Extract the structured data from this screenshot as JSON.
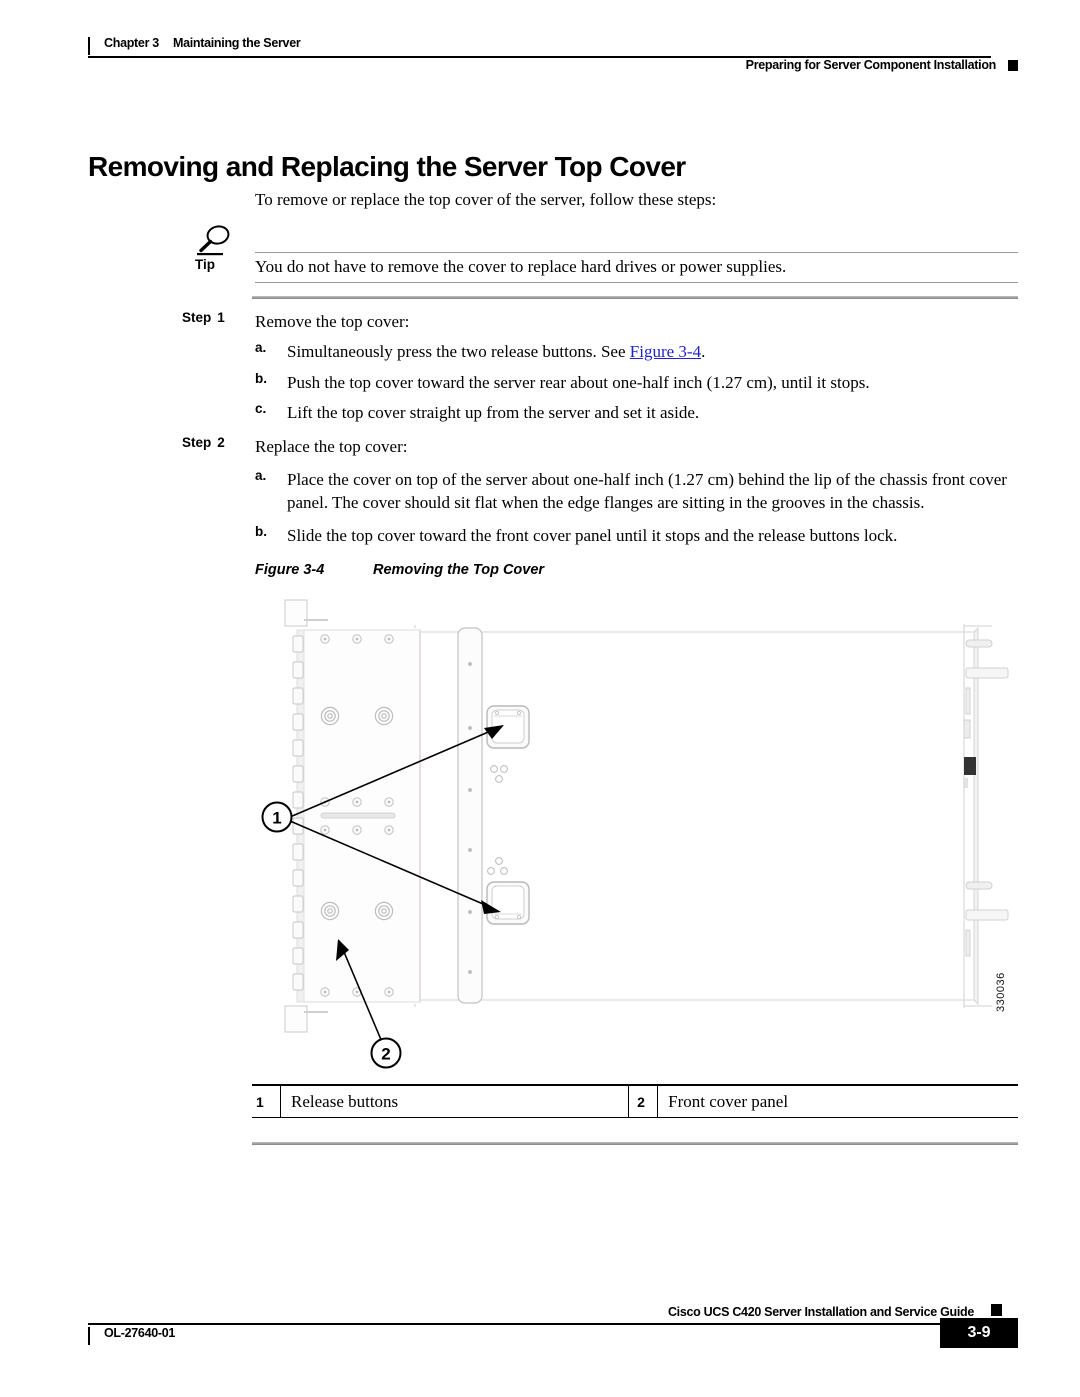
{
  "header": {
    "chapter_number": "Chapter 3",
    "chapter_title": "Maintaining the Server",
    "running_head": "Preparing for Server Component Installation"
  },
  "section": {
    "title": "Removing and Replacing the Server Top Cover",
    "intro": "To remove or replace the top cover of the server, follow these steps:"
  },
  "tip": {
    "label": "Tip",
    "icon": "magnifying-glass-icon",
    "text": "You do not have to remove the cover to replace hard drives or power supplies."
  },
  "steps": [
    {
      "label": "Step",
      "number": "1",
      "text": "Remove the top cover:",
      "substeps": [
        {
          "letter": "a.",
          "text_before": "Simultaneously press the two release buttons. See ",
          "link": "Figure 3-4",
          "text_after": "."
        },
        {
          "letter": "b.",
          "text_before": "Push the top cover toward the server rear about one-half inch (1.27 cm), until it stops.",
          "link": "",
          "text_after": ""
        },
        {
          "letter": "c.",
          "text_before": "Lift the top cover straight up from the server and set it aside.",
          "link": "",
          "text_after": ""
        }
      ]
    },
    {
      "label": "Step",
      "number": "2",
      "text": "Replace the top cover:",
      "substeps": [
        {
          "letter": "a.",
          "text_before": "Place the cover on top of the server about one-half inch (1.27 cm) behind the lip of the chassis front cover panel. The cover should sit flat when the edge flanges are sitting in the grooves in the chassis.",
          "link": "",
          "text_after": ""
        },
        {
          "letter": "b.",
          "text_before": "Slide the top cover toward the front cover panel until it stops and the release buttons lock.",
          "link": "",
          "text_after": ""
        }
      ]
    }
  ],
  "figure": {
    "number": "Figure 3-4",
    "title": "Removing the Top Cover",
    "graphic_id": "330036",
    "callouts": [
      {
        "number": "1",
        "target": "release-buttons"
      },
      {
        "number": "2",
        "target": "front-cover-panel"
      }
    ]
  },
  "legend": {
    "items": [
      {
        "number": "1",
        "description": "Release buttons"
      },
      {
        "number": "2",
        "description": "Front cover panel"
      }
    ]
  },
  "footer": {
    "doc_id": "OL-27640-01",
    "guide_title": "Cisco UCS C420 Server Installation and Service Guide",
    "page_number": "3-9"
  },
  "colors": {
    "link": "#2222cc",
    "rule_gray": "#b6b6b6",
    "text": "#000000",
    "line_art": "#d9d9d9"
  }
}
